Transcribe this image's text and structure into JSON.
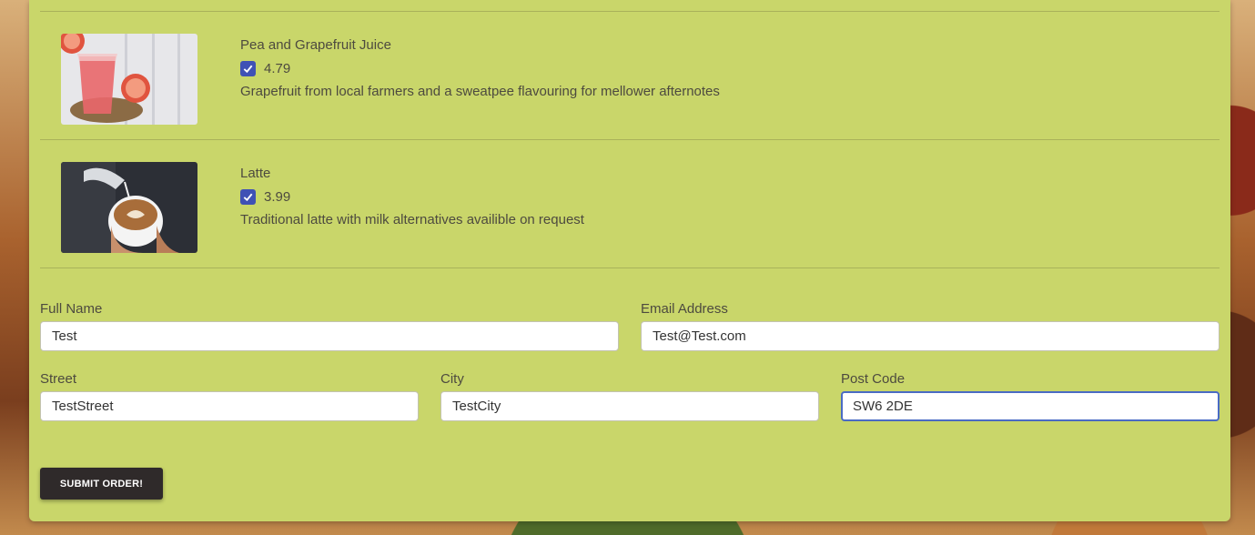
{
  "items": [
    {
      "name": "Pea and Grapefruit Juice",
      "price": "4.79",
      "checked": true,
      "description": "Grapefruit from local farmers and a sweatpee flavouring for mellower afternotes",
      "image_icon": "grapefruit-juice-photo"
    },
    {
      "name": "Latte",
      "price": "3.99",
      "checked": true,
      "description": "Traditional latte with milk alternatives availible on request",
      "image_icon": "latte-photo"
    }
  ],
  "form": {
    "full_name": {
      "label": "Full Name",
      "value": "Test"
    },
    "email": {
      "label": "Email Address",
      "value": "Test@Test.com"
    },
    "street": {
      "label": "Street",
      "value": "TestStreet"
    },
    "city": {
      "label": "City",
      "value": "TestCity"
    },
    "post_code": {
      "label": "Post Code",
      "value": "SW6 2DE"
    }
  },
  "submit_label": "SUBMIT ORDER!",
  "colors": {
    "panel": "#c9d66a",
    "checkbox": "#3f51b5",
    "focus_border": "#4a6bc4",
    "button": "#2f2a2a"
  }
}
